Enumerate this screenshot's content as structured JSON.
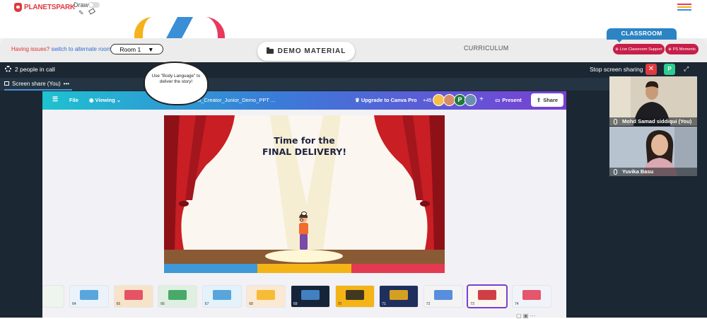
{
  "header": {
    "logo_text": "PLANETSPARK",
    "draw_label": "Draw",
    "menu_colors": [
      "#e8395d",
      "#f5b21b",
      "#3a8fd6"
    ]
  },
  "room_bar": {
    "issues_question": "Having issues?",
    "issues_link": "switch to alternate room",
    "room_select": "Room 1",
    "demo_material": "DEMO MATERIAL",
    "curriculum": "CURRICULUM",
    "classroom_tab": "CLASSROOM",
    "live_support": "Live Classroom Support",
    "ps_moments": "PS Moments"
  },
  "call": {
    "people_count": "2 people in call",
    "stop_sharing": "Stop screen sharing",
    "close_glyph": "✕",
    "avatar_letter": "P",
    "screen_share_tab": "Screen share (You)",
    "more_glyph": "•••"
  },
  "canva": {
    "file": "File",
    "viewing": "Viewing",
    "doc_title": "Final_Creator_Junior_Demo_PPT ...",
    "upgrade": "Upgrade to Canva Pro",
    "collab_count": "+45",
    "collab_letter": "P",
    "plus": "+",
    "present": "Present",
    "share": "Share"
  },
  "slide": {
    "title_line1": "Time for the",
    "title_line2": "FINAL DELIVERY!",
    "cloud_text": "Use \"Body Language\" to deliver the story!"
  },
  "thumbnails": [
    {
      "num": "64"
    },
    {
      "num": "65"
    },
    {
      "num": "66"
    },
    {
      "num": "67"
    },
    {
      "num": "68"
    },
    {
      "num": "69"
    },
    {
      "num": "70"
    },
    {
      "num": "71"
    },
    {
      "num": "72"
    },
    {
      "num": "73",
      "selected": true
    },
    {
      "num": "74"
    }
  ],
  "participants": [
    {
      "name": "Mohd Samad siddiqui (You)"
    },
    {
      "name": "Yuvika Basu"
    }
  ],
  "colors": {
    "brand_red": "#e0393e",
    "call_bg": "#1b2733",
    "classroom_blue": "#2b84c4",
    "pill_red": "#c71f4a",
    "canva_purple": "#7a3fd4"
  }
}
